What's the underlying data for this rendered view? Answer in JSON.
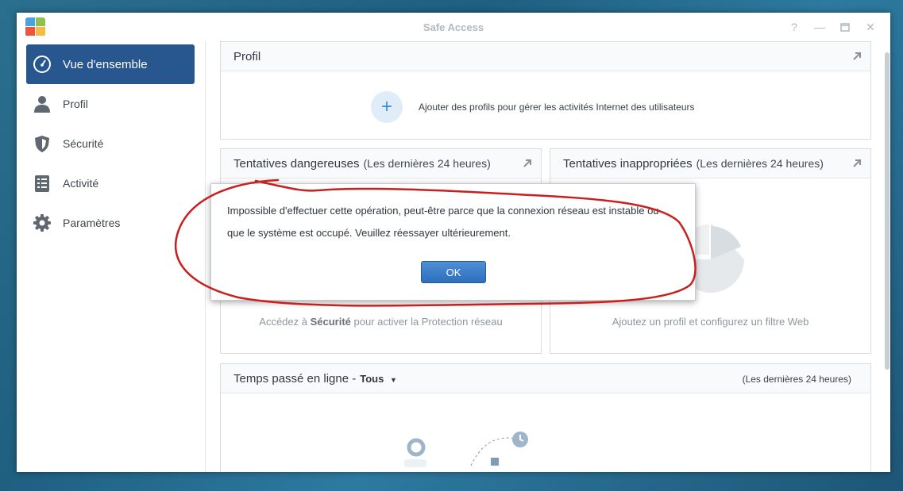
{
  "window": {
    "title": "Safe Access"
  },
  "sidebar": {
    "items": [
      {
        "label": "Vue d'ensemble",
        "icon": "dashboard-gauge-icon",
        "active": true
      },
      {
        "label": "Profil",
        "icon": "user-icon"
      },
      {
        "label": "Sécurité",
        "icon": "shield-icon"
      },
      {
        "label": "Activité",
        "icon": "activity-list-icon"
      },
      {
        "label": "Paramètres",
        "icon": "gear-icon"
      }
    ]
  },
  "main": {
    "profile_panel": {
      "title": "Profil",
      "message": "Ajouter des profils pour gérer les activités Internet des utilisateurs"
    },
    "dangerous_panel": {
      "title": "Tentatives dangereuses",
      "subtitle": "(Les dernières 24 heures)",
      "prefix": "Accédez à",
      "link": "Sécurité",
      "suffix": "pour activer la Protection réseau"
    },
    "inappropriate_panel": {
      "title": "Tentatives inappropriées",
      "subtitle": "(Les dernières 24 heures)",
      "message": "Ajoutez un profil et configurez un filtre Web"
    },
    "time_panel": {
      "title": "Temps passé en ligne -",
      "filter": "Tous",
      "range": "(Les dernières 24 heures)"
    }
  },
  "dialog": {
    "message": "Impossible d'effectuer cette opération, peut-être parce que la connexion réseau est instable ou que le système est occupé. Veuillez réessayer ultérieurement.",
    "ok_label": "OK"
  },
  "colors": {
    "accent": "#27578e",
    "ok_button": "#2e6fbd",
    "annotation": "#c8201e"
  }
}
